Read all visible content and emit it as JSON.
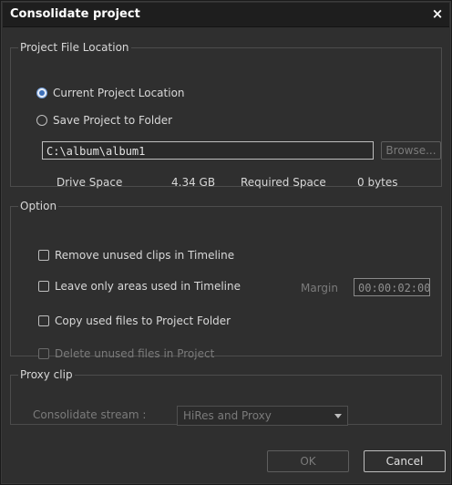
{
  "window": {
    "title": "Consolidate project",
    "close_glyph": "×"
  },
  "project_file_location": {
    "legend": "Project File Location",
    "option_current": "Current Project Location",
    "option_save": "Save Project to Folder",
    "path_value": "C:\\album\\album1",
    "browse_label": "Browse...",
    "drive_space_label": "Drive Space",
    "drive_space_value": "4.34 GB",
    "required_space_label": "Required Space",
    "required_space_value": "0 bytes"
  },
  "option": {
    "legend": "Option",
    "remove_unused": "Remove unused clips in Timeline",
    "leave_only_areas": "Leave only areas used in Timeline",
    "margin_label": "Margin",
    "margin_value": "00:00:02:00",
    "copy_used_files": "Copy used files to Project Folder",
    "delete_unused": "Delete unused files in Project"
  },
  "proxy_clip": {
    "legend": "Proxy clip",
    "consolidate_stream_label": "Consolidate stream :",
    "stream_selected": "HiRes and Proxy"
  },
  "footer": {
    "ok_label": "OK",
    "cancel_label": "Cancel"
  },
  "colors": {
    "dialog_bg": "#2f2f2f",
    "titlebar_bg": "#1e1e1e",
    "text": "#d8d8d8",
    "disabled_text": "#7b7b7b",
    "radio_selected": "#3c6fb8"
  }
}
